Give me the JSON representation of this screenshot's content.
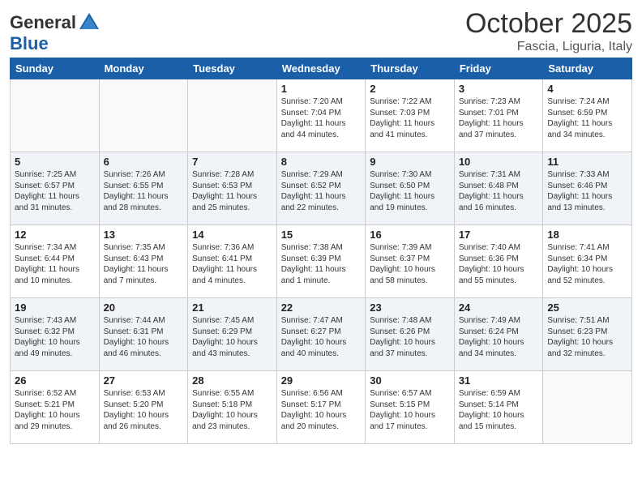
{
  "header": {
    "logo_general": "General",
    "logo_blue": "Blue",
    "month_title": "October 2025",
    "location": "Fascia, Liguria, Italy"
  },
  "weekdays": [
    "Sunday",
    "Monday",
    "Tuesday",
    "Wednesday",
    "Thursday",
    "Friday",
    "Saturday"
  ],
  "weeks": [
    [
      {
        "day": "",
        "info": ""
      },
      {
        "day": "",
        "info": ""
      },
      {
        "day": "",
        "info": ""
      },
      {
        "day": "1",
        "info": "Sunrise: 7:20 AM\nSunset: 7:04 PM\nDaylight: 11 hours and 44 minutes."
      },
      {
        "day": "2",
        "info": "Sunrise: 7:22 AM\nSunset: 7:03 PM\nDaylight: 11 hours and 41 minutes."
      },
      {
        "day": "3",
        "info": "Sunrise: 7:23 AM\nSunset: 7:01 PM\nDaylight: 11 hours and 37 minutes."
      },
      {
        "day": "4",
        "info": "Sunrise: 7:24 AM\nSunset: 6:59 PM\nDaylight: 11 hours and 34 minutes."
      }
    ],
    [
      {
        "day": "5",
        "info": "Sunrise: 7:25 AM\nSunset: 6:57 PM\nDaylight: 11 hours and 31 minutes."
      },
      {
        "day": "6",
        "info": "Sunrise: 7:26 AM\nSunset: 6:55 PM\nDaylight: 11 hours and 28 minutes."
      },
      {
        "day": "7",
        "info": "Sunrise: 7:28 AM\nSunset: 6:53 PM\nDaylight: 11 hours and 25 minutes."
      },
      {
        "day": "8",
        "info": "Sunrise: 7:29 AM\nSunset: 6:52 PM\nDaylight: 11 hours and 22 minutes."
      },
      {
        "day": "9",
        "info": "Sunrise: 7:30 AM\nSunset: 6:50 PM\nDaylight: 11 hours and 19 minutes."
      },
      {
        "day": "10",
        "info": "Sunrise: 7:31 AM\nSunset: 6:48 PM\nDaylight: 11 hours and 16 minutes."
      },
      {
        "day": "11",
        "info": "Sunrise: 7:33 AM\nSunset: 6:46 PM\nDaylight: 11 hours and 13 minutes."
      }
    ],
    [
      {
        "day": "12",
        "info": "Sunrise: 7:34 AM\nSunset: 6:44 PM\nDaylight: 11 hours and 10 minutes."
      },
      {
        "day": "13",
        "info": "Sunrise: 7:35 AM\nSunset: 6:43 PM\nDaylight: 11 hours and 7 minutes."
      },
      {
        "day": "14",
        "info": "Sunrise: 7:36 AM\nSunset: 6:41 PM\nDaylight: 11 hours and 4 minutes."
      },
      {
        "day": "15",
        "info": "Sunrise: 7:38 AM\nSunset: 6:39 PM\nDaylight: 11 hours and 1 minute."
      },
      {
        "day": "16",
        "info": "Sunrise: 7:39 AM\nSunset: 6:37 PM\nDaylight: 10 hours and 58 minutes."
      },
      {
        "day": "17",
        "info": "Sunrise: 7:40 AM\nSunset: 6:36 PM\nDaylight: 10 hours and 55 minutes."
      },
      {
        "day": "18",
        "info": "Sunrise: 7:41 AM\nSunset: 6:34 PM\nDaylight: 10 hours and 52 minutes."
      }
    ],
    [
      {
        "day": "19",
        "info": "Sunrise: 7:43 AM\nSunset: 6:32 PM\nDaylight: 10 hours and 49 minutes."
      },
      {
        "day": "20",
        "info": "Sunrise: 7:44 AM\nSunset: 6:31 PM\nDaylight: 10 hours and 46 minutes."
      },
      {
        "day": "21",
        "info": "Sunrise: 7:45 AM\nSunset: 6:29 PM\nDaylight: 10 hours and 43 minutes."
      },
      {
        "day": "22",
        "info": "Sunrise: 7:47 AM\nSunset: 6:27 PM\nDaylight: 10 hours and 40 minutes."
      },
      {
        "day": "23",
        "info": "Sunrise: 7:48 AM\nSunset: 6:26 PM\nDaylight: 10 hours and 37 minutes."
      },
      {
        "day": "24",
        "info": "Sunrise: 7:49 AM\nSunset: 6:24 PM\nDaylight: 10 hours and 34 minutes."
      },
      {
        "day": "25",
        "info": "Sunrise: 7:51 AM\nSunset: 6:23 PM\nDaylight: 10 hours and 32 minutes."
      }
    ],
    [
      {
        "day": "26",
        "info": "Sunrise: 6:52 AM\nSunset: 5:21 PM\nDaylight: 10 hours and 29 minutes."
      },
      {
        "day": "27",
        "info": "Sunrise: 6:53 AM\nSunset: 5:20 PM\nDaylight: 10 hours and 26 minutes."
      },
      {
        "day": "28",
        "info": "Sunrise: 6:55 AM\nSunset: 5:18 PM\nDaylight: 10 hours and 23 minutes."
      },
      {
        "day": "29",
        "info": "Sunrise: 6:56 AM\nSunset: 5:17 PM\nDaylight: 10 hours and 20 minutes."
      },
      {
        "day": "30",
        "info": "Sunrise: 6:57 AM\nSunset: 5:15 PM\nDaylight: 10 hours and 17 minutes."
      },
      {
        "day": "31",
        "info": "Sunrise: 6:59 AM\nSunset: 5:14 PM\nDaylight: 10 hours and 15 minutes."
      },
      {
        "day": "",
        "info": ""
      }
    ]
  ]
}
